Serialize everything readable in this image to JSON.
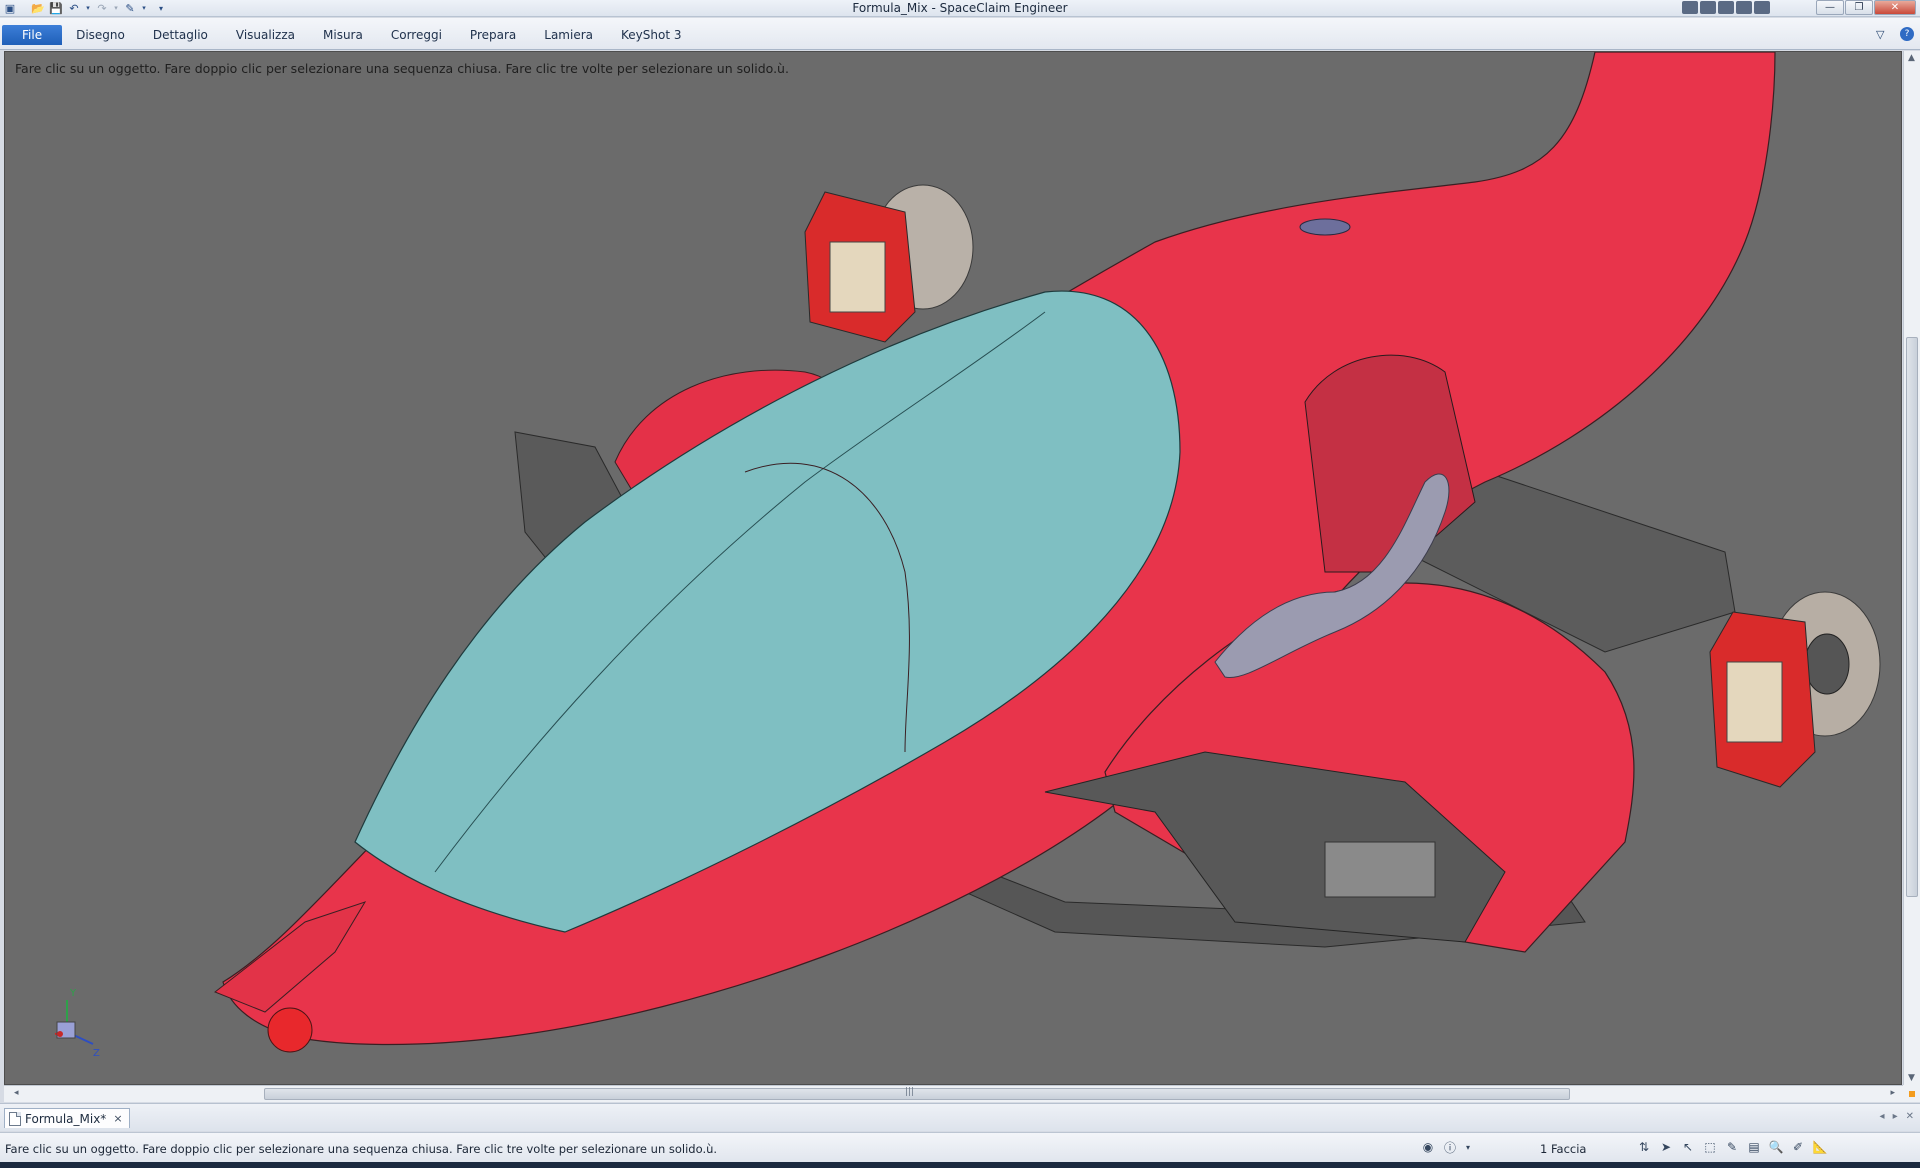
{
  "window": {
    "title": "Formula_Mix - SpaceClaim Engineer"
  },
  "ribbon": {
    "tabs": [
      {
        "label": "File"
      },
      {
        "label": "Disegno"
      },
      {
        "label": "Dettaglio"
      },
      {
        "label": "Visualizza"
      },
      {
        "label": "Misura"
      },
      {
        "label": "Correggi"
      },
      {
        "label": "Prepara"
      },
      {
        "label": "Lamiera"
      },
      {
        "label": "KeyShot 3"
      }
    ]
  },
  "viewport": {
    "hint": "Fare clic su un oggetto. Fare doppio clic per selezionare una sequenza chiusa. Fare clic tre volte per selezionare un solido.ù.",
    "axes": {
      "y": "Y",
      "z": "Z"
    },
    "colors": {
      "background": "#6b6b6b",
      "body": "#e8344b",
      "canopy": "#7fbfc2",
      "floor": "#555555",
      "caliper": "#d92b2b"
    }
  },
  "document_tab": {
    "label": "Formula_Mix*",
    "close": "×"
  },
  "statusbar": {
    "message": "Fare clic su un oggetto. Fare doppio clic per selezionare una sequenza chiusa. Fare clic tre volte per selezionare un solido.ù.",
    "selection": "1 Faccia"
  }
}
